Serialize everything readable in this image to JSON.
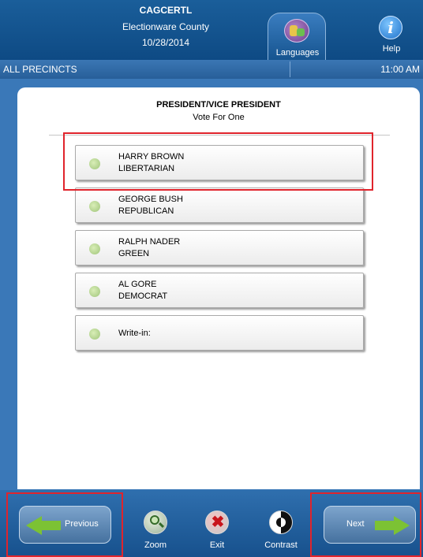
{
  "header": {
    "line1": "CAGCERTL",
    "line2": "Electionware County",
    "line3": "10/28/2014",
    "languages_label": "Languages",
    "help_label": "Help",
    "help_icon_glyph": "i"
  },
  "status_bar": {
    "precinct": "ALL PRECINCTS",
    "time": "11:00 AM"
  },
  "contest": {
    "title": "PRESIDENT/VICE PRESIDENT",
    "subtitle": "Vote For One",
    "candidates": [
      {
        "name": "HARRY BROWN",
        "party": "LIBERTARIAN"
      },
      {
        "name": "GEORGE BUSH",
        "party": "REPUBLICAN"
      },
      {
        "name": "RALPH NADER",
        "party": "GREEN"
      },
      {
        "name": "AL GORE",
        "party": "DEMOCRAT"
      }
    ],
    "write_in_label": "Write-in:"
  },
  "footer": {
    "previous_label": "Previous",
    "next_label": "Next",
    "zoom_label": "Zoom",
    "exit_label": "Exit",
    "exit_glyph": "✖",
    "contrast_label": "Contrast"
  },
  "colors": {
    "header_blue": "#0e4a84",
    "frame_blue": "#3a78b8",
    "radio_green": "#9fc47a",
    "arrow_green": "#7cc234",
    "highlight_red": "#e0242c"
  }
}
